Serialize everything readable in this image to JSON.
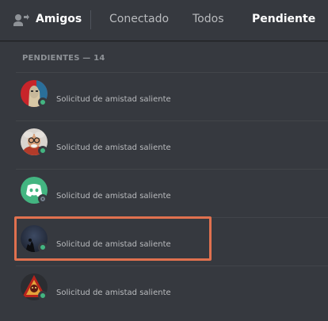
{
  "header": {
    "title": "Amigos",
    "tabs": [
      {
        "label": "Conectado"
      },
      {
        "label": "Todos"
      },
      {
        "label": "Pendiente",
        "selected": true
      }
    ],
    "icon": "friends-icon"
  },
  "section": {
    "label": "PENDIENTES — 14"
  },
  "requests": [
    {
      "text": "Solicitud de amistad saliente",
      "status": "online",
      "avatar": "red-poster-portrait"
    },
    {
      "text": "Solicitud de amistad saliente",
      "status": "online",
      "avatar": "scientist-with-glasses"
    },
    {
      "text": "Solicitud de amistad saliente",
      "status": "offline",
      "avatar": "discord-default-green"
    },
    {
      "text": "Solicitud de amistad saliente",
      "status": "online",
      "avatar": "dark-silhouette",
      "highlighted": true
    },
    {
      "text": "Solicitud de amistad saliente",
      "status": "online",
      "avatar": "red-emblem"
    }
  ],
  "colors": {
    "background": "#36393f",
    "online": "#43b581",
    "highlight": "#e0714f",
    "discord_green": "#43b581"
  }
}
